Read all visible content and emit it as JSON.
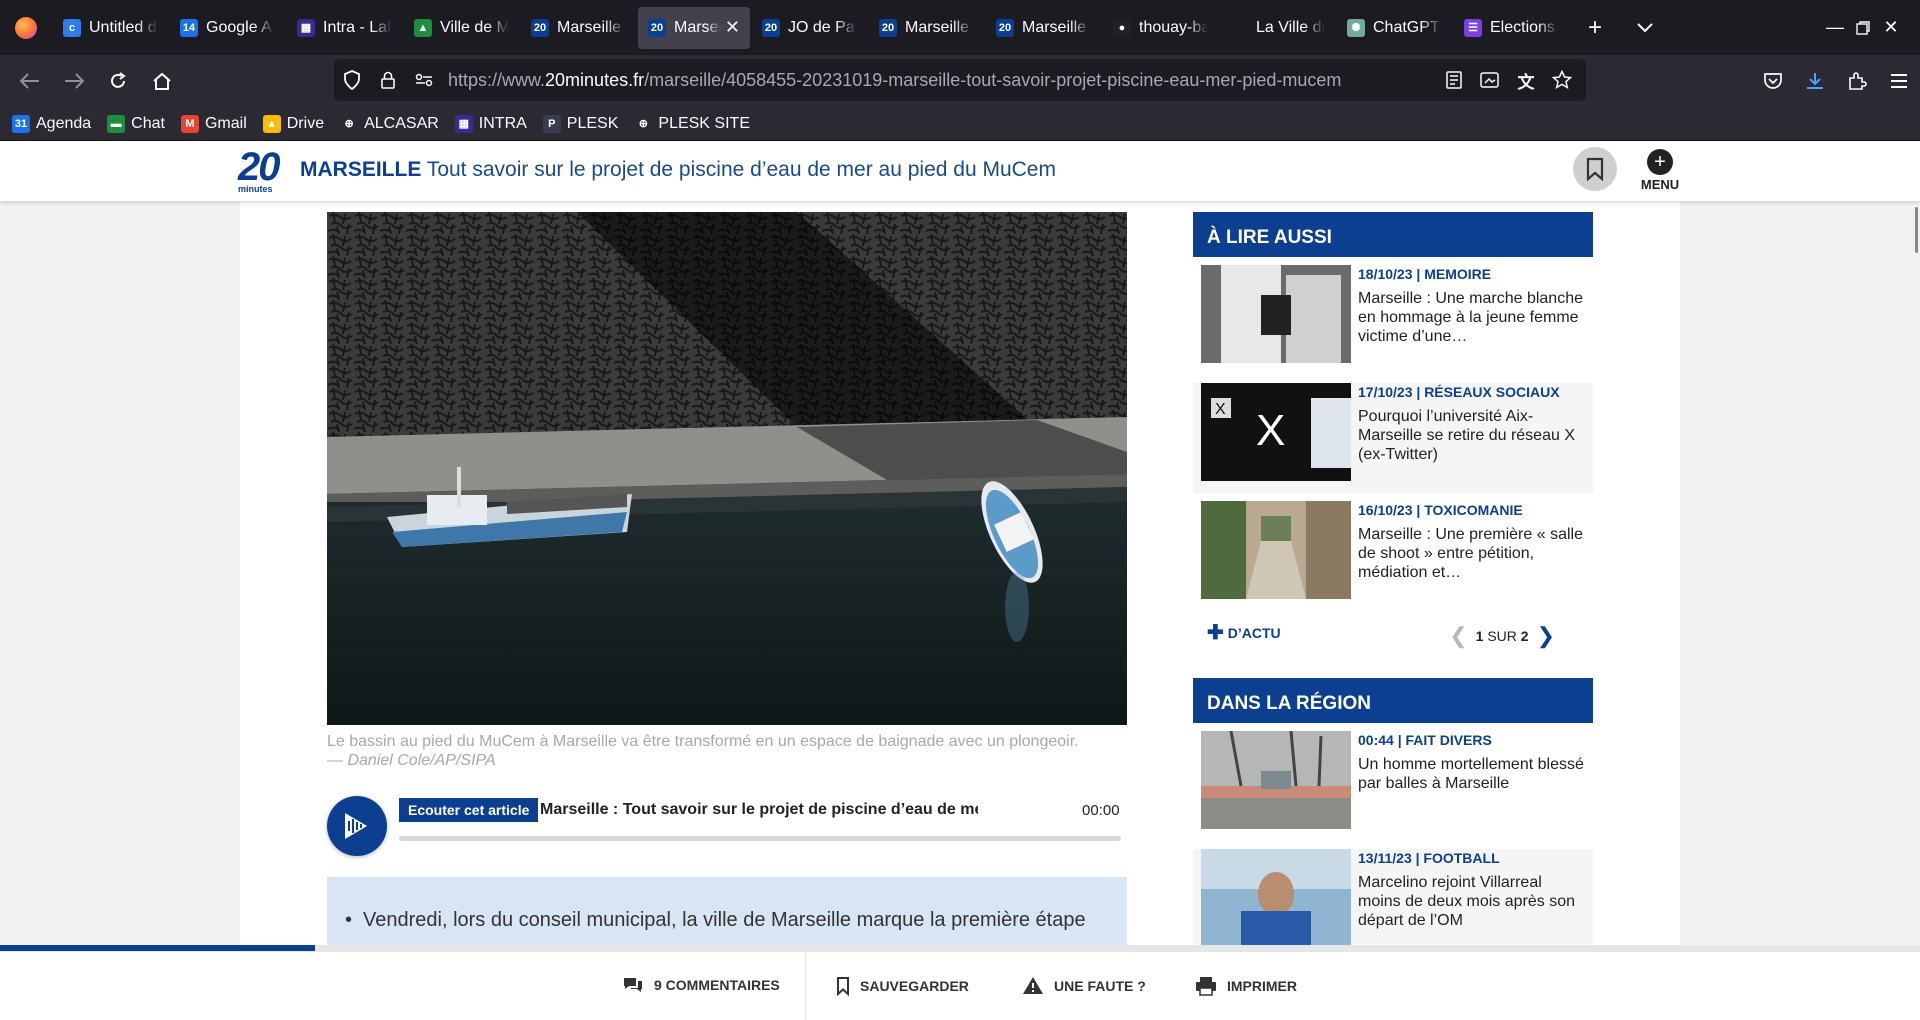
{
  "browser": {
    "tabs": [
      {
        "label": "Untitled d",
        "icon": "c",
        "color": "#2b7de9"
      },
      {
        "label": "Google A",
        "icon": "14",
        "color": "#1a73e8"
      },
      {
        "label": "Intra - LaP",
        "icon": "▦",
        "color": "#3b2a8f"
      },
      {
        "label": "Ville de M",
        "icon": "▲",
        "color": "#1e8e3e"
      },
      {
        "label": "Marseille",
        "icon": "20",
        "color": "#0c3f8f"
      },
      {
        "label": "Marseil",
        "icon": "20",
        "color": "#0c3f8f",
        "active": true
      },
      {
        "label": "JO de Pari",
        "icon": "20",
        "color": "#0c3f8f"
      },
      {
        "label": "Marseille",
        "icon": "20",
        "color": "#0c3f8f"
      },
      {
        "label": "Marseille",
        "icon": "20",
        "color": "#0c3f8f"
      },
      {
        "label": "thouay-ba",
        "icon": "●",
        "color": "#222"
      },
      {
        "label": "La Ville de M",
        "icon": "",
        "color": "#1c1b22"
      },
      {
        "label": "ChatGPT",
        "icon": "✺",
        "color": "#74aa9c"
      },
      {
        "label": "Elections",
        "icon": "☰",
        "color": "#7b3fe4"
      }
    ],
    "url_prefix": "https://www.",
    "url_domain": "20minutes.fr",
    "url_path": "/marseille/4058455-20231019-marseille-tout-savoir-projet-piscine-eau-mer-pied-mucem",
    "bookmarks": [
      {
        "label": "Agenda",
        "icon": "31",
        "color": "#1a73e8"
      },
      {
        "label": "Chat",
        "icon": "▬",
        "color": "#1e8e3e"
      },
      {
        "label": "Gmail",
        "icon": "M",
        "color": "#ea4335"
      },
      {
        "label": "Drive",
        "icon": "▲",
        "color": "#fbbc04"
      },
      {
        "label": "ALCASAR",
        "icon": "⊕",
        "color": "#2b2a33"
      },
      {
        "label": "INTRA",
        "icon": "▦",
        "color": "#3b2a8f"
      },
      {
        "label": "PLESK",
        "icon": "P",
        "color": "#3a3a50"
      },
      {
        "label": "PLESK SITE",
        "icon": "⊕",
        "color": "#2b2a33"
      }
    ]
  },
  "header": {
    "logo_number": "20",
    "logo_sub": "minutes",
    "section": "MARSEILLE",
    "title": "Tout savoir sur le projet de piscine d’eau de mer au pied du MuCem",
    "menu_label": "MENU"
  },
  "article": {
    "caption": "Le bassin au pied du MuCem à Marseille va être transformé en un espace de baignade avec un plongeoir.",
    "credit": "— Daniel Cole/AP/SIPA",
    "player": {
      "tag": "Ecouter cet article",
      "title": "Marseille : Tout savoir sur le projet de piscine d’eau de mer au pied du MuCem",
      "time": "00:00"
    },
    "summary_first": "Vendredi, lors du conseil municipal, la ville de Marseille marque la première étape"
  },
  "sidebar": {
    "lire_aussi": {
      "heading": "À LIRE AUSSI",
      "items": [
        {
          "meta": "18/10/23 | MEMOIRE",
          "text": "Marseille : Une marche blanche en hommage à la jeune femme victime d’une…"
        },
        {
          "meta": "17/10/23 | RÉSEAUX SOCIAUX",
          "text": "Pourquoi l’université Aix-Marseille se retire du réseau X (ex-Twitter)"
        },
        {
          "meta": "16/10/23 | TOXICOMANIE",
          "text": "Marseille : Une première « salle de shoot » entre pétition, médiation et…"
        }
      ],
      "more_label": "D’ACTU",
      "pager_current": "1",
      "pager_sep": "SUR",
      "pager_total": "2"
    },
    "region": {
      "heading": "DANS LA RÉGION",
      "items": [
        {
          "meta": "00:44 | FAIT DIVERS",
          "text": "Un homme mortellement blessé par balles à Marseille"
        },
        {
          "meta": "13/11/23 | FOOTBALL",
          "text": "Marcelino rejoint Villarreal moins de deux mois après son départ de l’OM"
        }
      ]
    }
  },
  "reading_progress_fraction": 0.164,
  "bottom_bar": {
    "comments": "9 COMMENTAIRES",
    "save": "SAUVEGARDER",
    "error": "UNE FAUTE ?",
    "print": "IMPRIMER"
  },
  "colors": {
    "brand": "#0c3f8f",
    "summary_bg": "#d7e5f5"
  }
}
